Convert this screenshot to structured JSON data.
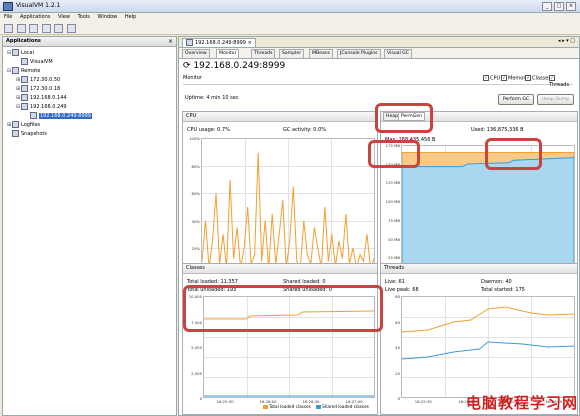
{
  "window": {
    "title": "VisualVM 1.2.1",
    "buttons": [
      "_",
      "□",
      "×"
    ]
  },
  "menu": [
    "File",
    "Applications",
    "View",
    "Tools",
    "Window",
    "Help"
  ],
  "left_panel": {
    "title": "Applications",
    "tree": [
      {
        "label": "Local",
        "indent": 0,
        "toggle": "⊟"
      },
      {
        "label": "VisualVM",
        "indent": 1,
        "toggle": ""
      },
      {
        "label": "Remote",
        "indent": 0,
        "toggle": "⊟"
      },
      {
        "label": "172.30.0.50",
        "indent": 1,
        "toggle": "⊞"
      },
      {
        "label": "172.30.0.18",
        "indent": 1,
        "toggle": "⊞"
      },
      {
        "label": "192.168.0.144",
        "indent": 1,
        "toggle": "⊞"
      },
      {
        "label": "192.168.0.249",
        "indent": 1,
        "toggle": "⊟"
      },
      {
        "label": "192.168.0.249:8999",
        "indent": 2,
        "toggle": "",
        "selected": true
      },
      {
        "label": "Logfiles",
        "indent": 0,
        "toggle": "⊞"
      },
      {
        "label": "Snapshots",
        "indent": 0,
        "toggle": ""
      }
    ]
  },
  "main_tab": "192.168.0.249:8999",
  "subtabs": [
    "Overview",
    "Monitor",
    "Threads",
    "Sampler",
    "MBeans",
    "JConsole Plugins",
    "Visual GC"
  ],
  "active_subtab": "Monitor",
  "host_title": "192.168.0.249:8999",
  "monitor": {
    "label": "Monitor",
    "checks": [
      "CPU",
      "Memory",
      "Classes",
      "Threads"
    ],
    "uptime": "Uptime: 4 min 10 sec",
    "perform_gc": "Perform GC",
    "heap_dump": "Heap Dump"
  },
  "cpu_panel": {
    "title": "CPU",
    "cpu_usage": "CPU usage: 0.7%",
    "gc_activity": "GC activity: 0.0%",
    "yticks": [
      "100%",
      "80%",
      "60%",
      "40%",
      "20%",
      "0%"
    ],
    "xticks": [
      "16:25:30",
      "16:26:00",
      "16:26:30",
      "16:27:00"
    ],
    "legend": [
      "CPU usage",
      "GC activity"
    ]
  },
  "heap_panel": {
    "tabs": [
      "Heap",
      "PermGen"
    ],
    "active_tab": "PermGen",
    "max": "Max: 268,435,456 B",
    "used": "Used: 136,875,336 B",
    "yticks": [
      "175 MB",
      "150 MB",
      "125 MB",
      "100 MB",
      "75 MB",
      "50 MB",
      "25 MB",
      "0 MB"
    ],
    "xticks": [
      "16:25:30",
      "16:26:00",
      "16:26:30",
      "16:27:00"
    ],
    "legend": [
      "PermGen size",
      "Used PermGen"
    ]
  },
  "classes_panel": {
    "title": "Classes",
    "total_loaded": "Total loaded: 11,357",
    "shared_loaded": "Shared loaded: 0",
    "total_unloaded": "Total unloaded: 193",
    "shared_unloaded": "Shared unloaded: 0",
    "yticks": [
      "10,000",
      "7,500",
      "5,000",
      "2,500",
      "0"
    ],
    "xticks": [
      "16:25:30",
      "16:26:00",
      "16:26:30",
      "16:27:00"
    ],
    "legend": [
      "Total loaded classes",
      "Shared loaded classes"
    ]
  },
  "threads_panel": {
    "title": "Threads",
    "live": "Live: 61",
    "daemon": "Daemon: 40",
    "live_peak": "Live peak: 68",
    "total_started": "Total started: 175",
    "yticks": [
      "80",
      "60",
      "40",
      "20",
      "0"
    ],
    "xticks": [
      "16:25:30",
      "16:26:00",
      "16:26:30",
      "16:27:00"
    ],
    "legend": [
      "Live threads",
      "Daemon threads"
    ]
  },
  "colors": {
    "orange": "#f0a030",
    "blue": "#3a9ad9",
    "annotation": "#c8453f",
    "selection": "#316ac5"
  },
  "watermark": "电脑教程学习网"
}
